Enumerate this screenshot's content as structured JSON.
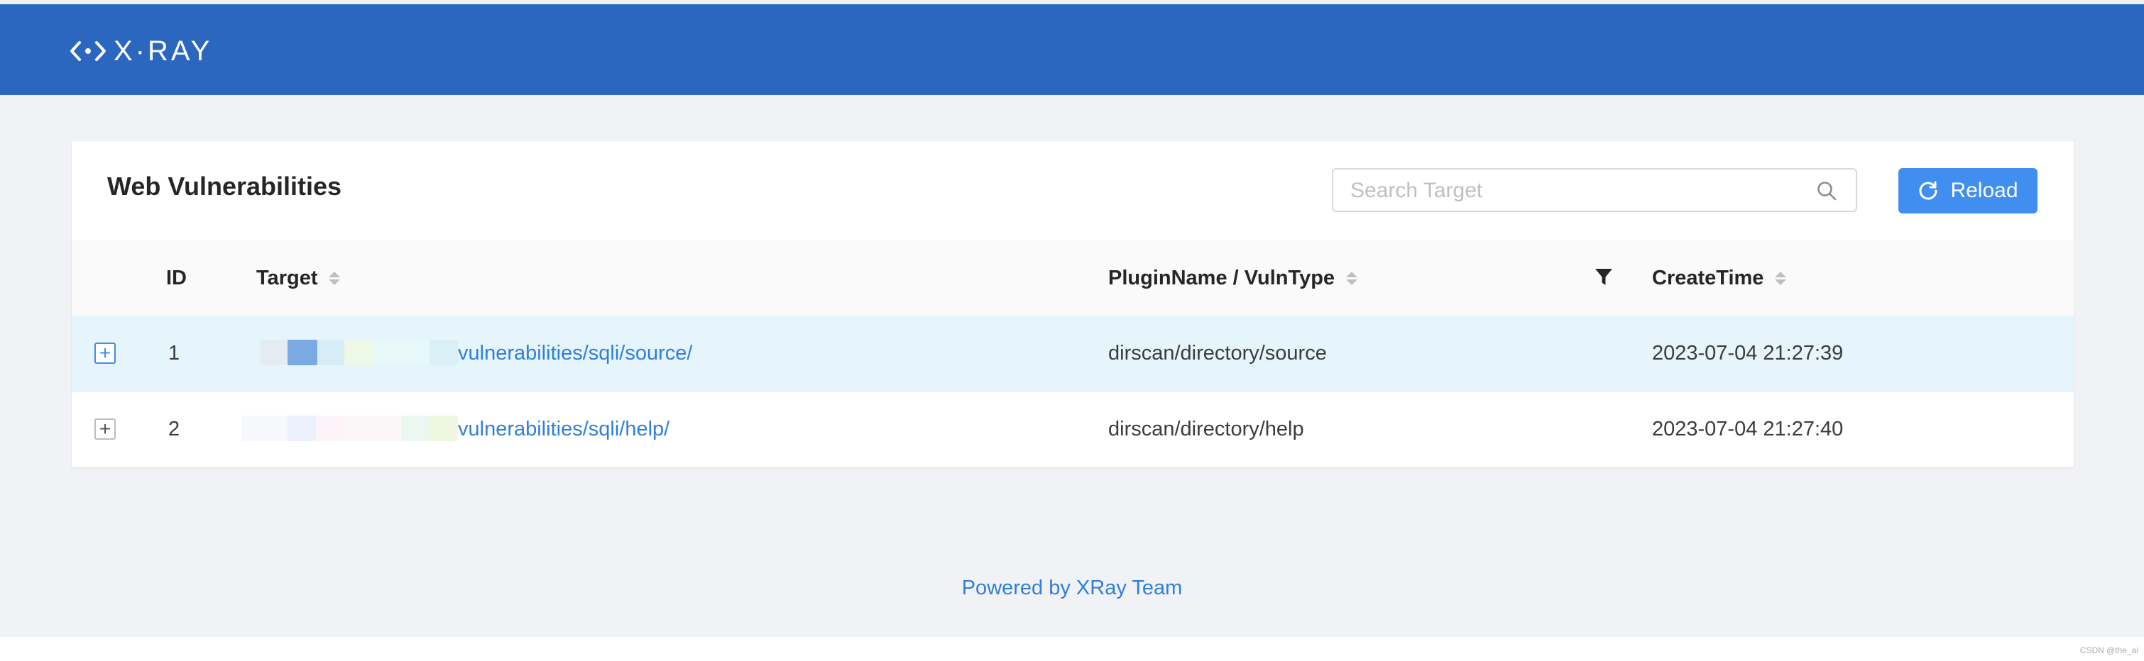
{
  "brand": {
    "name": "X·RAY"
  },
  "page": {
    "title": "Web Vulnerabilities"
  },
  "search": {
    "placeholder": "Search Target",
    "value": ""
  },
  "reload_button": {
    "label": "Reload"
  },
  "table": {
    "columns": {
      "id": "ID",
      "target": "Target",
      "plugin": "PluginName / VulnType",
      "create_time": "CreateTime"
    },
    "rows": [
      {
        "id": "1",
        "target_path": "vulnerabilities/sqli/source/",
        "plugin": "dirscan/directory/source",
        "create_time": "2023-07-04 21:27:39",
        "selected": true
      },
      {
        "id": "2",
        "target_path": "vulnerabilities/sqli/help/",
        "plugin": "dirscan/directory/help",
        "create_time": "2023-07-04 21:27:40",
        "selected": false
      }
    ],
    "expand_symbol": "+"
  },
  "footer": {
    "text": "Powered by XRay Team"
  },
  "watermark": "CSDN @the_ai",
  "colors": {
    "header": "#2b66bf",
    "accent": "#3f8ef0",
    "link": "#2f7fd9",
    "selected_row": "#e6f4fc"
  }
}
